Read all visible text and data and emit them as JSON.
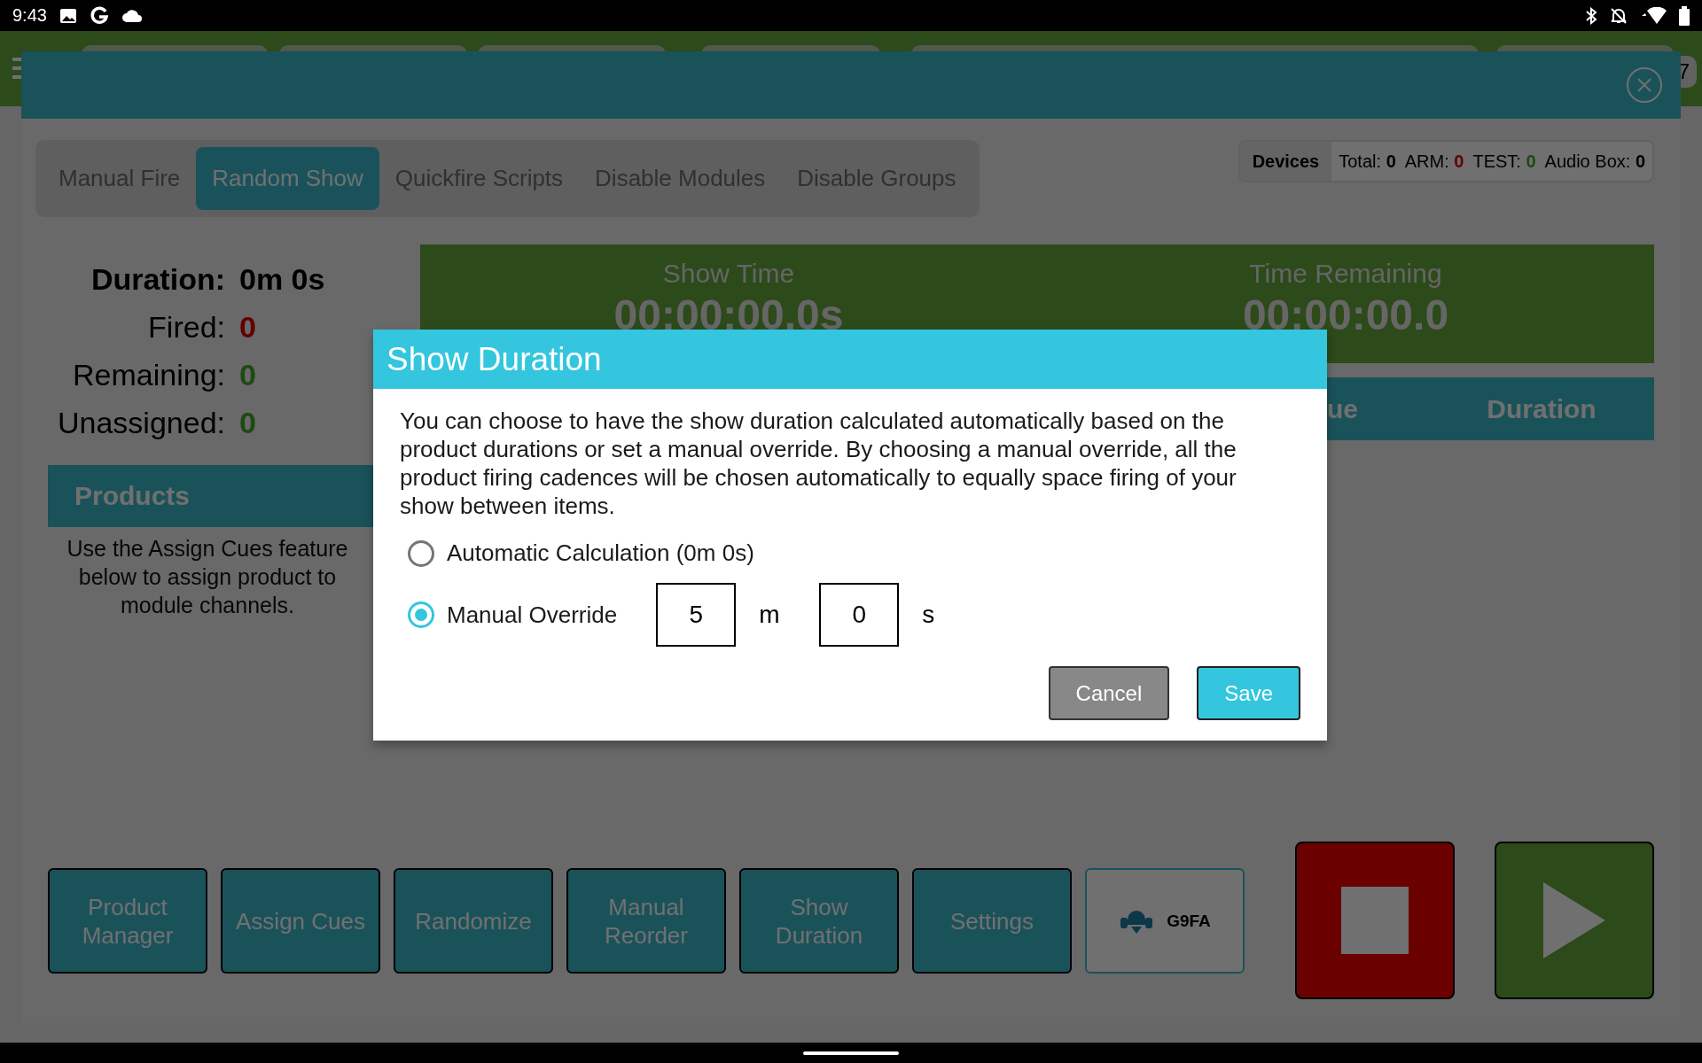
{
  "status_bar": {
    "time": "9:43"
  },
  "app_bar": {
    "badge": "7"
  },
  "tabs": [
    {
      "label": "Manual Fire",
      "selected": false
    },
    {
      "label": "Random Show",
      "selected": true
    },
    {
      "label": "Quickfire Scripts",
      "selected": false
    },
    {
      "label": "Disable Modules",
      "selected": false
    },
    {
      "label": "Disable Groups",
      "selected": false
    }
  ],
  "devices": {
    "title": "Devices",
    "counts": [
      {
        "label": "Total:",
        "value": "0",
        "kind": "neutral"
      },
      {
        "label": "ARM:",
        "value": "0",
        "kind": "alert"
      },
      {
        "label": "TEST:",
        "value": "0",
        "kind": "ok"
      },
      {
        "label": "Audio Box:",
        "value": "0",
        "kind": "neutral"
      }
    ]
  },
  "stats": [
    {
      "label": "Duration:",
      "value": "0m 0s",
      "kind": "bold"
    },
    {
      "label": "Fired:",
      "value": "0",
      "kind": "alert"
    },
    {
      "label": "Remaining:",
      "value": "0",
      "kind": "ok"
    },
    {
      "label": "Unassigned:",
      "value": "0",
      "kind": "ok"
    }
  ],
  "timers": [
    {
      "label": "Show Time",
      "value": "00:00:00.0s"
    },
    {
      "label": "Time Remaining",
      "value": "00:00:00.0"
    }
  ],
  "cue_table": {
    "columns": [
      "ue",
      "Duration"
    ]
  },
  "products": {
    "title": "Products",
    "hint": "Use the Assign Cues feature below to assign product to module channels."
  },
  "actions": [
    {
      "label": "Product Manager",
      "kind": "action"
    },
    {
      "label": "Assign Cues",
      "kind": "action"
    },
    {
      "label": "Randomize",
      "kind": "action"
    },
    {
      "label": "Manual Reorder",
      "kind": "action"
    },
    {
      "label": "Show Duration",
      "kind": "action"
    },
    {
      "label": "Settings",
      "kind": "action"
    },
    {
      "label": "G9FA",
      "kind": "device"
    }
  ],
  "dialog": {
    "title": "Show Duration",
    "message": "You can choose to have the show duration calculated automatically based on the product durations or set a manual override. By choosing a manual override, all the product firing cadences will be chosen automatically to equally space firing of your show between items.",
    "options": [
      {
        "label": "Automatic Calculation (0m 0s)",
        "selected": false
      },
      {
        "label": "Manual Override",
        "selected": true
      }
    ],
    "minutes": {
      "value": "5",
      "unit": "m"
    },
    "seconds": {
      "value": "0",
      "unit": "s"
    },
    "buttons": [
      {
        "label": "Cancel",
        "kind": "secondary"
      },
      {
        "label": "Save",
        "kind": "primary"
      }
    ]
  }
}
